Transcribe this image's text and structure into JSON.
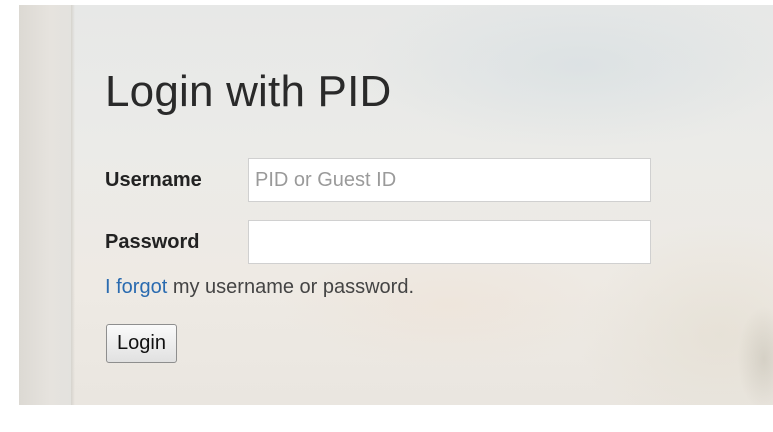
{
  "login": {
    "title": "Login with PID",
    "username_label": "Username",
    "username_placeholder": "PID or Guest ID",
    "username_value": "",
    "password_label": "Password",
    "password_value": "",
    "forgot_link_text": "I forgot",
    "forgot_rest_text": " my username or password.",
    "login_button_label": "Login"
  },
  "colors": {
    "link": "#2a6bb0",
    "text": "#222222",
    "background": "#e9e9e6"
  }
}
